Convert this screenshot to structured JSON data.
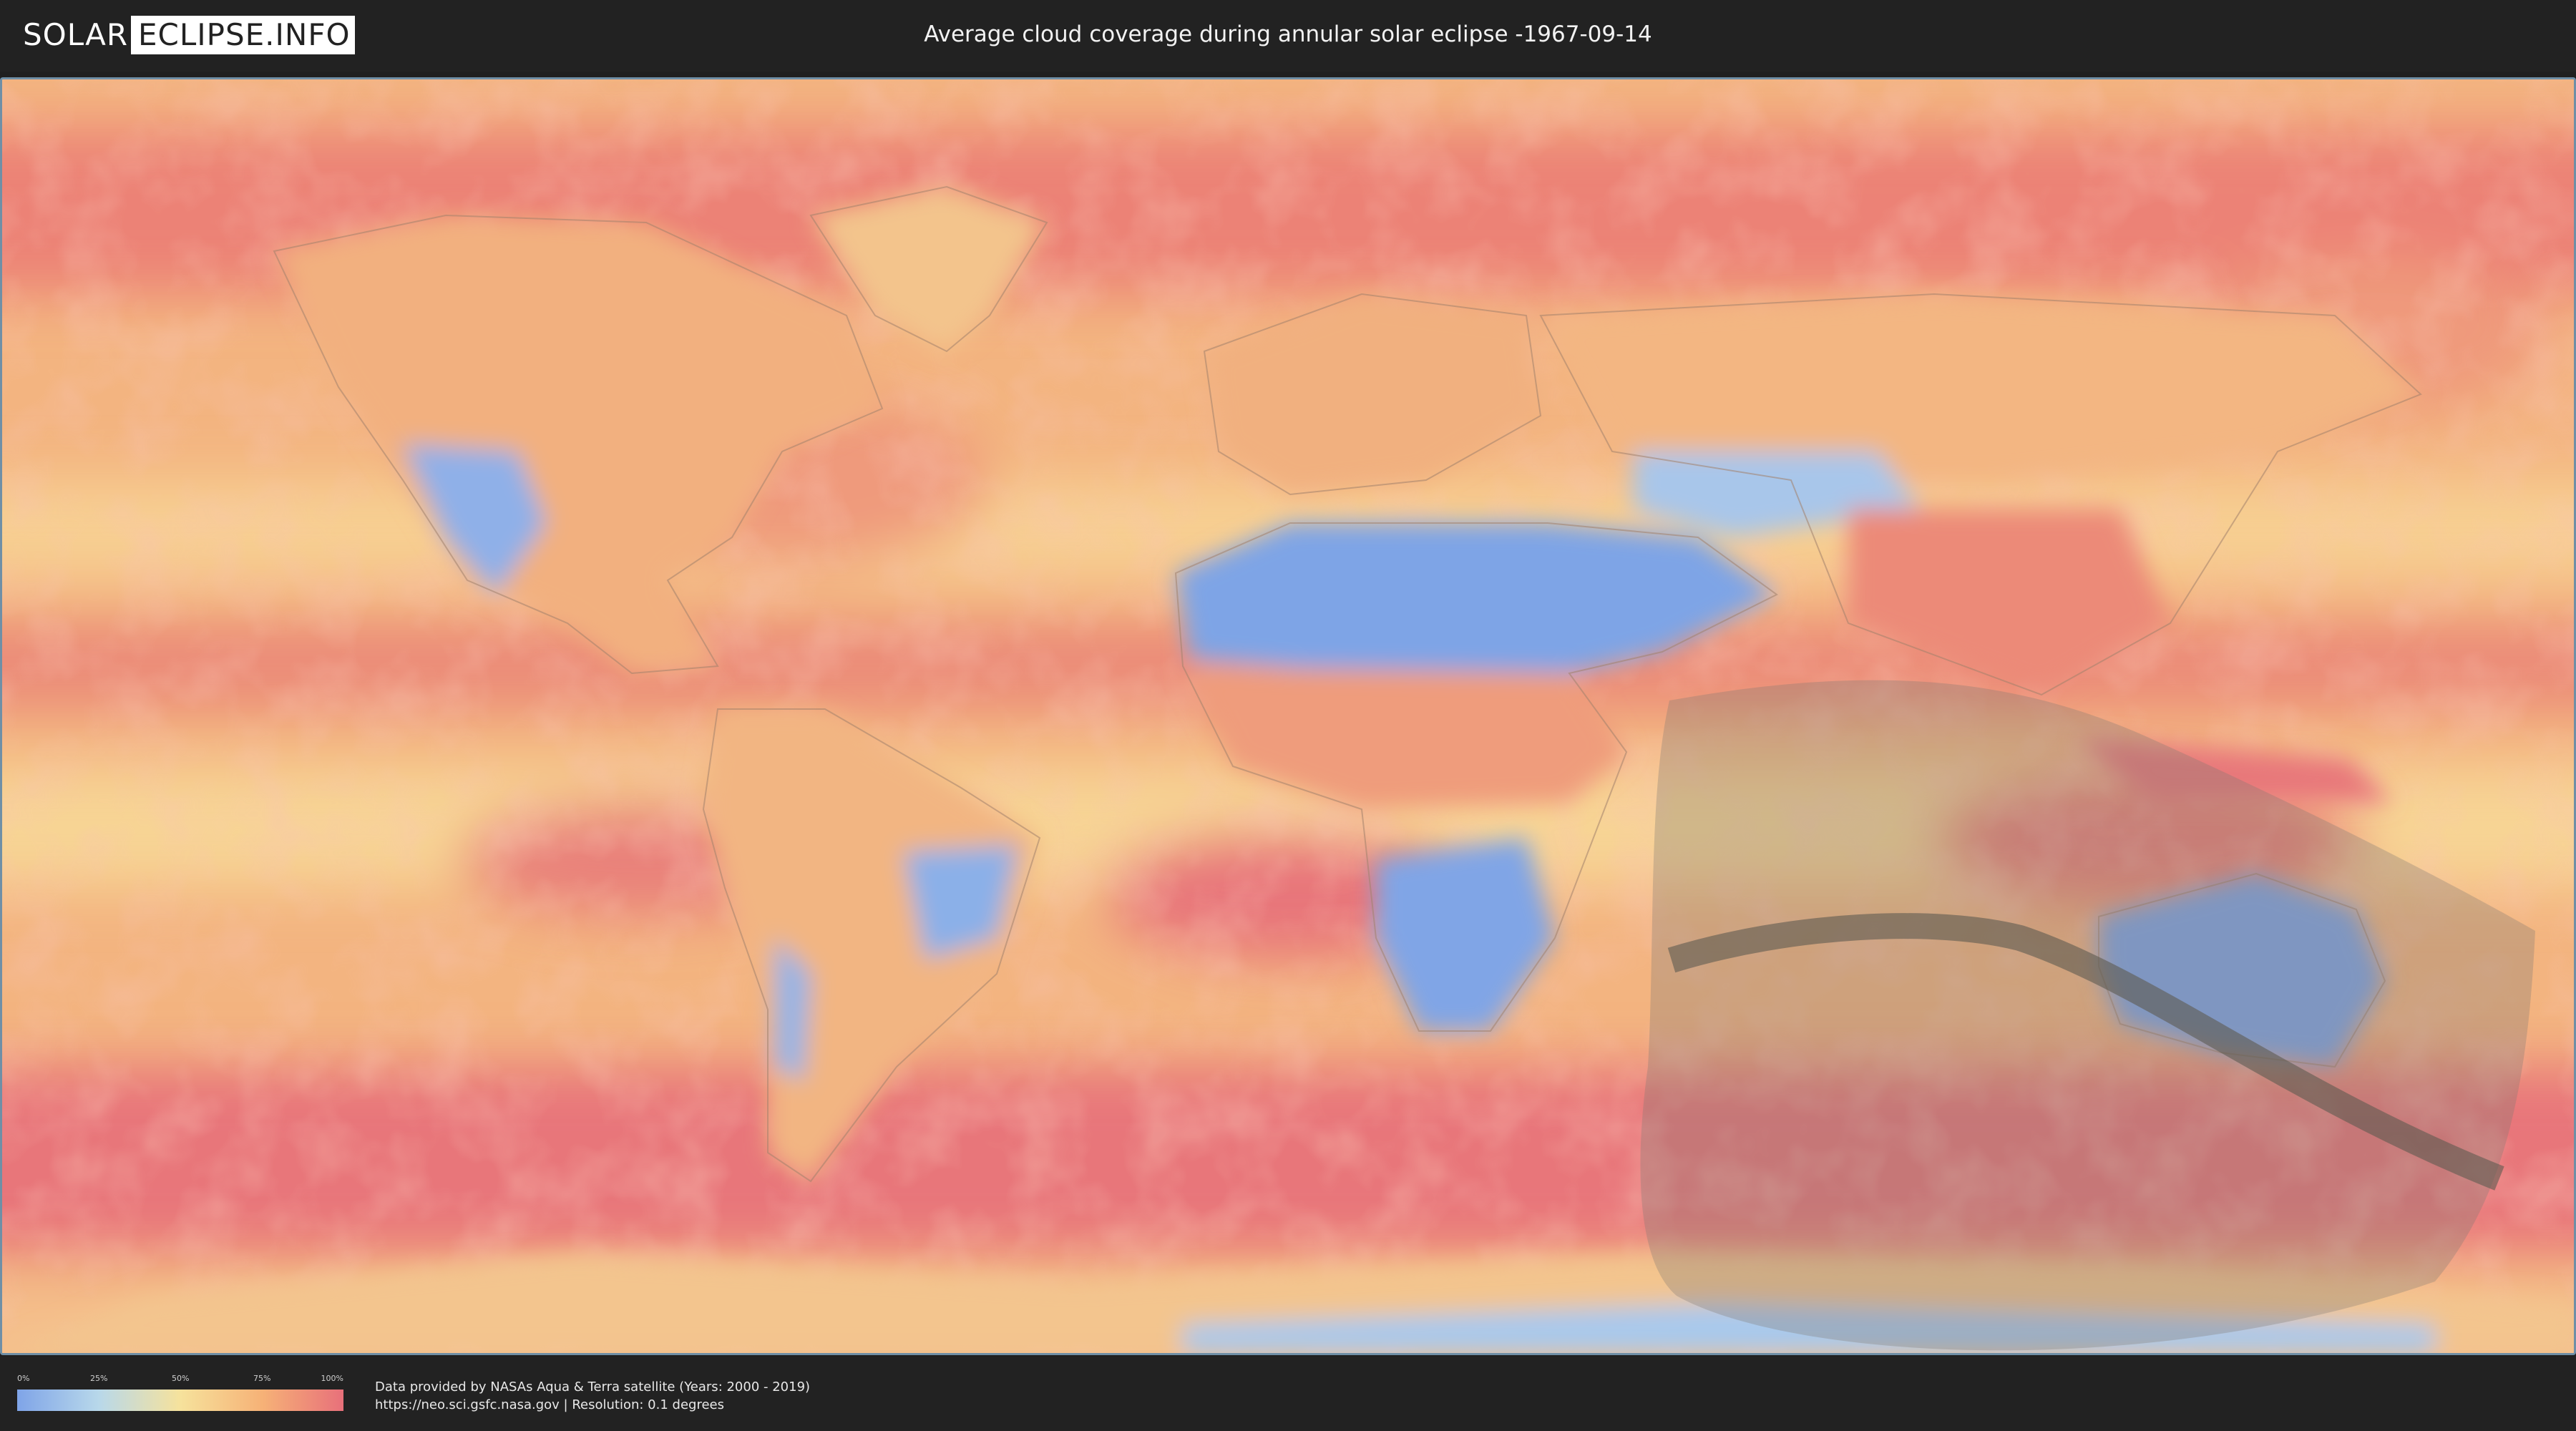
{
  "header": {
    "logo_left": "SOLAR",
    "logo_right": "ECLIPSE.INFO",
    "title": "Average cloud coverage during annular solar eclipse -1967-09-14"
  },
  "legend": {
    "ticks": [
      "0%",
      "25%",
      "50%",
      "75%",
      "100%"
    ],
    "colors": [
      "#7fa4e8",
      "#b8d8ea",
      "#f6e29c",
      "#f6b277",
      "#e8707a"
    ]
  },
  "credits": {
    "line1": "Data provided by NASAs Aqua & Terra satellite (Years: 2000 - 2019)",
    "line2": "https://neo.sci.gsfc.nasa.gov | Resolution: 0.1 degrees"
  },
  "map": {
    "projection": "equirectangular",
    "eclipse_type": "annular",
    "colors": {
      "ocean_cloudy": "#f0a07a",
      "clear": "#7fa4e8",
      "overcast": "#e8707a",
      "partial_zone": "#807a72",
      "central_path": "#5e5a50",
      "coastline": "#a08070"
    }
  }
}
